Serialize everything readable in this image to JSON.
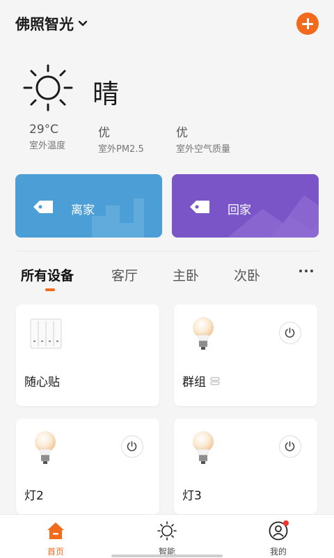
{
  "header": {
    "home_name": "佛照智光"
  },
  "weather": {
    "condition": "晴",
    "stats": [
      {
        "value": "29°C",
        "label": "室外温度"
      },
      {
        "value": "优",
        "label": "室外PM2.5"
      },
      {
        "value": "优",
        "label": "室外空气质量"
      }
    ]
  },
  "scenes": [
    {
      "label": "离家",
      "color": "#4c9fd6"
    },
    {
      "label": "回家",
      "color": "#7a55c8"
    }
  ],
  "tabs": [
    {
      "label": "所有设备",
      "active": true
    },
    {
      "label": "客厅",
      "active": false
    },
    {
      "label": "主卧",
      "active": false
    },
    {
      "label": "次卧",
      "active": false
    }
  ],
  "devices": [
    {
      "name": "随心贴",
      "icon": "switch-panel-icon",
      "has_power": false
    },
    {
      "name": "群组",
      "icon": "bulb-icon",
      "has_power": true,
      "group_badge": true
    },
    {
      "name": "灯2",
      "icon": "bulb-icon",
      "has_power": true
    },
    {
      "name": "灯3",
      "icon": "bulb-icon",
      "has_power": true
    }
  ],
  "nav": [
    {
      "label": "首页",
      "icon": "home-icon",
      "active": true
    },
    {
      "label": "智能",
      "icon": "sun-icon",
      "active": false
    },
    {
      "label": "我的",
      "icon": "user-icon",
      "active": false,
      "notification_dot": true
    }
  ],
  "colors": {
    "accent": "#f26b1d",
    "away_scene": "#4c9fd6",
    "home_scene": "#7a55c8"
  }
}
